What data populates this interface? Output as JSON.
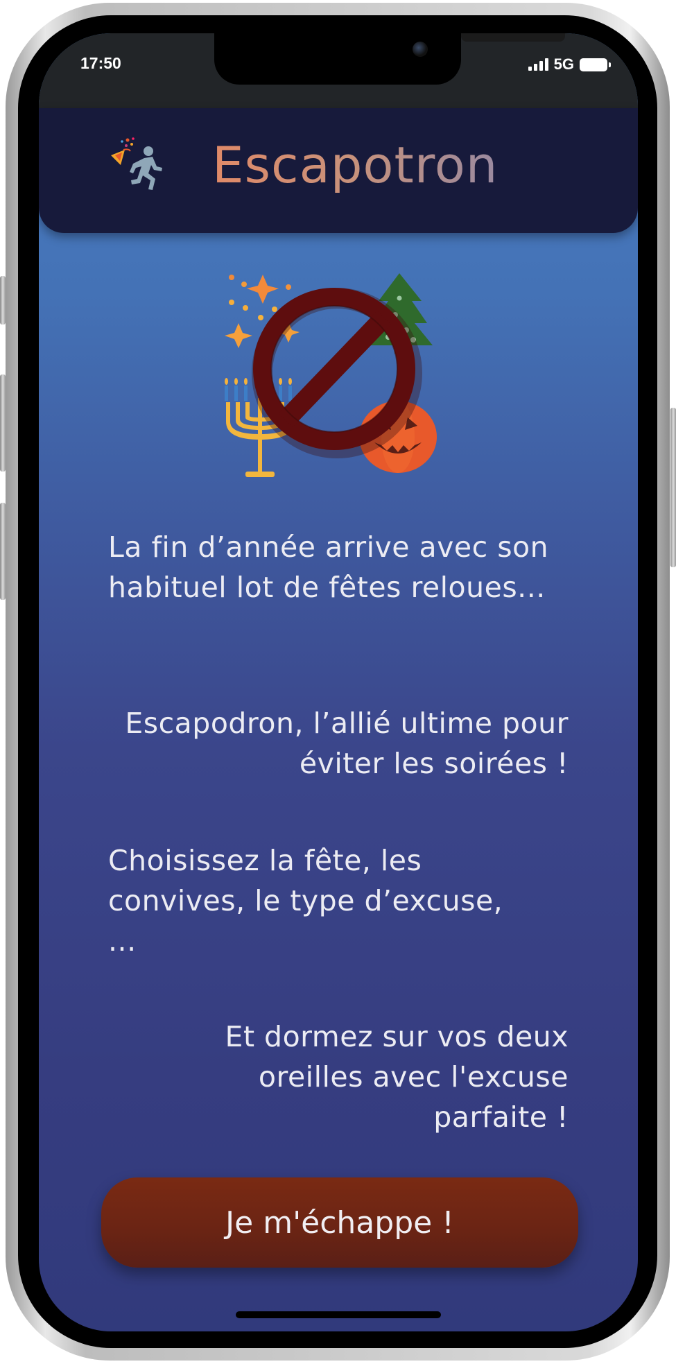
{
  "status_bar": {
    "time": "17:50",
    "network": "5G",
    "icons": [
      "signal-icon",
      "battery-icon"
    ]
  },
  "header": {
    "title": "Escapotron",
    "logo_icons": [
      "party-popper-icon",
      "running-person-icon"
    ]
  },
  "hero": {
    "icons": [
      "sparkles-icon",
      "christmas-tree-icon",
      "menorah-icon",
      "jack-o-lantern-icon",
      "prohibited-icon"
    ]
  },
  "intro": {
    "paragraph1": "La fin d’année arrive avec son habituel lot de fêtes reloues...",
    "paragraph2": "Escapodron, l’allié ultime pour éviter les soirées !",
    "paragraph3": "Choisissez la fête, les convives, le type d’excuse, ...",
    "paragraph4": "Et dormez sur vos deux oreilles avec l'excuse parfaite !"
  },
  "cta": {
    "label": "Je m'échappe !"
  },
  "colors": {
    "header_bg": "#171a3b",
    "title_gradient_start": "#e08a68",
    "title_gradient_end": "#9a8aa0",
    "button_bg": "#7a2a13",
    "body_gradient_top": "#4a7ec2",
    "body_gradient_bottom": "#313a7c"
  }
}
